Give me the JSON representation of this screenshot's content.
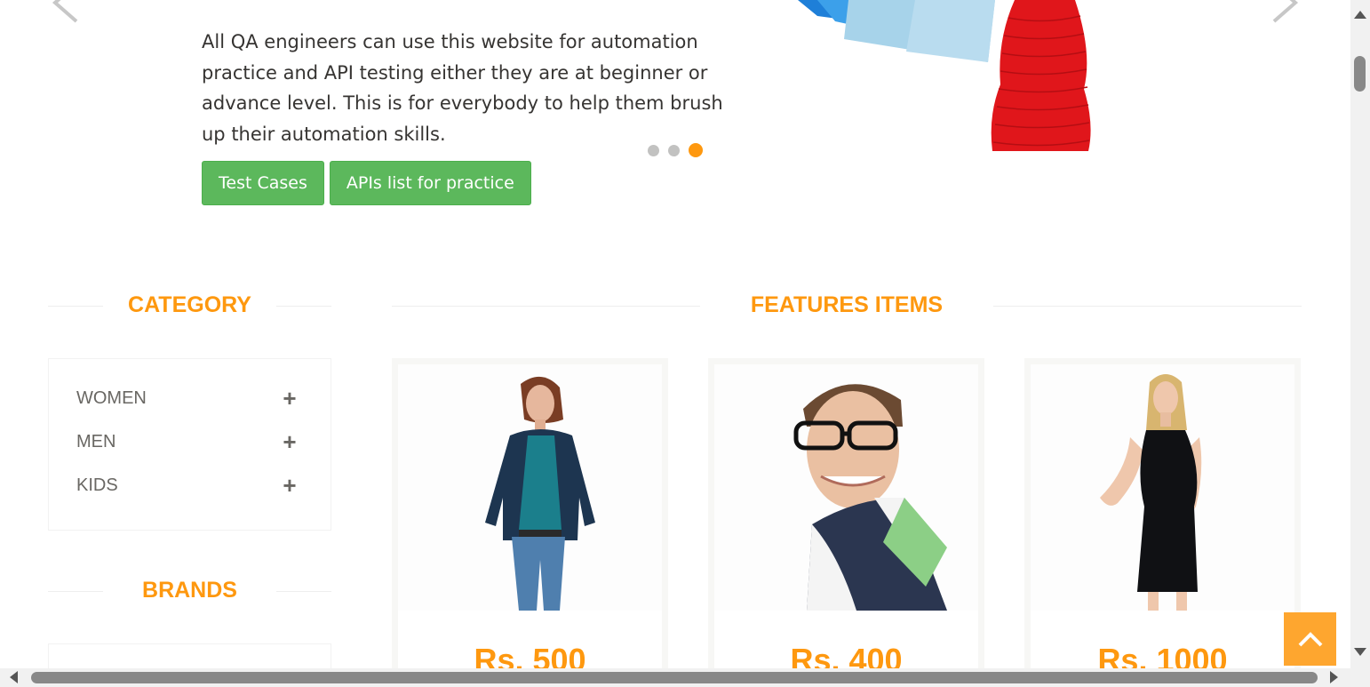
{
  "hero": {
    "description": "All QA engineers can use this website for automation practice and API testing either they are at beginner or advance level. This is for everybody to help them brush up their automation skills.",
    "buttons": {
      "test_cases": "Test Cases",
      "apis_list": "APIs list for practice"
    },
    "carousel": {
      "slide_count": 3,
      "active_slide": 3
    }
  },
  "sidebar": {
    "category_title": "CATEGORY",
    "categories": [
      {
        "label": "WOMEN",
        "icon": "plus-icon"
      },
      {
        "label": "MEN",
        "icon": "plus-icon"
      },
      {
        "label": "KIDS",
        "icon": "plus-icon"
      }
    ],
    "brands_title": "BRANDS"
  },
  "features": {
    "title": "FEATURES ITEMS",
    "products": [
      {
        "price": "Rs. 500"
      },
      {
        "price": "Rs. 400"
      },
      {
        "price": "Rs. 1000"
      }
    ]
  },
  "colors": {
    "accent": "#fe980f",
    "button_green": "#5cb85c",
    "scroll_up_bg": "#fea62f"
  },
  "icons": {
    "carousel_prev": "chevron-left-icon",
    "carousel_next": "chevron-right-icon",
    "scroll_up": "chevron-up-icon"
  }
}
